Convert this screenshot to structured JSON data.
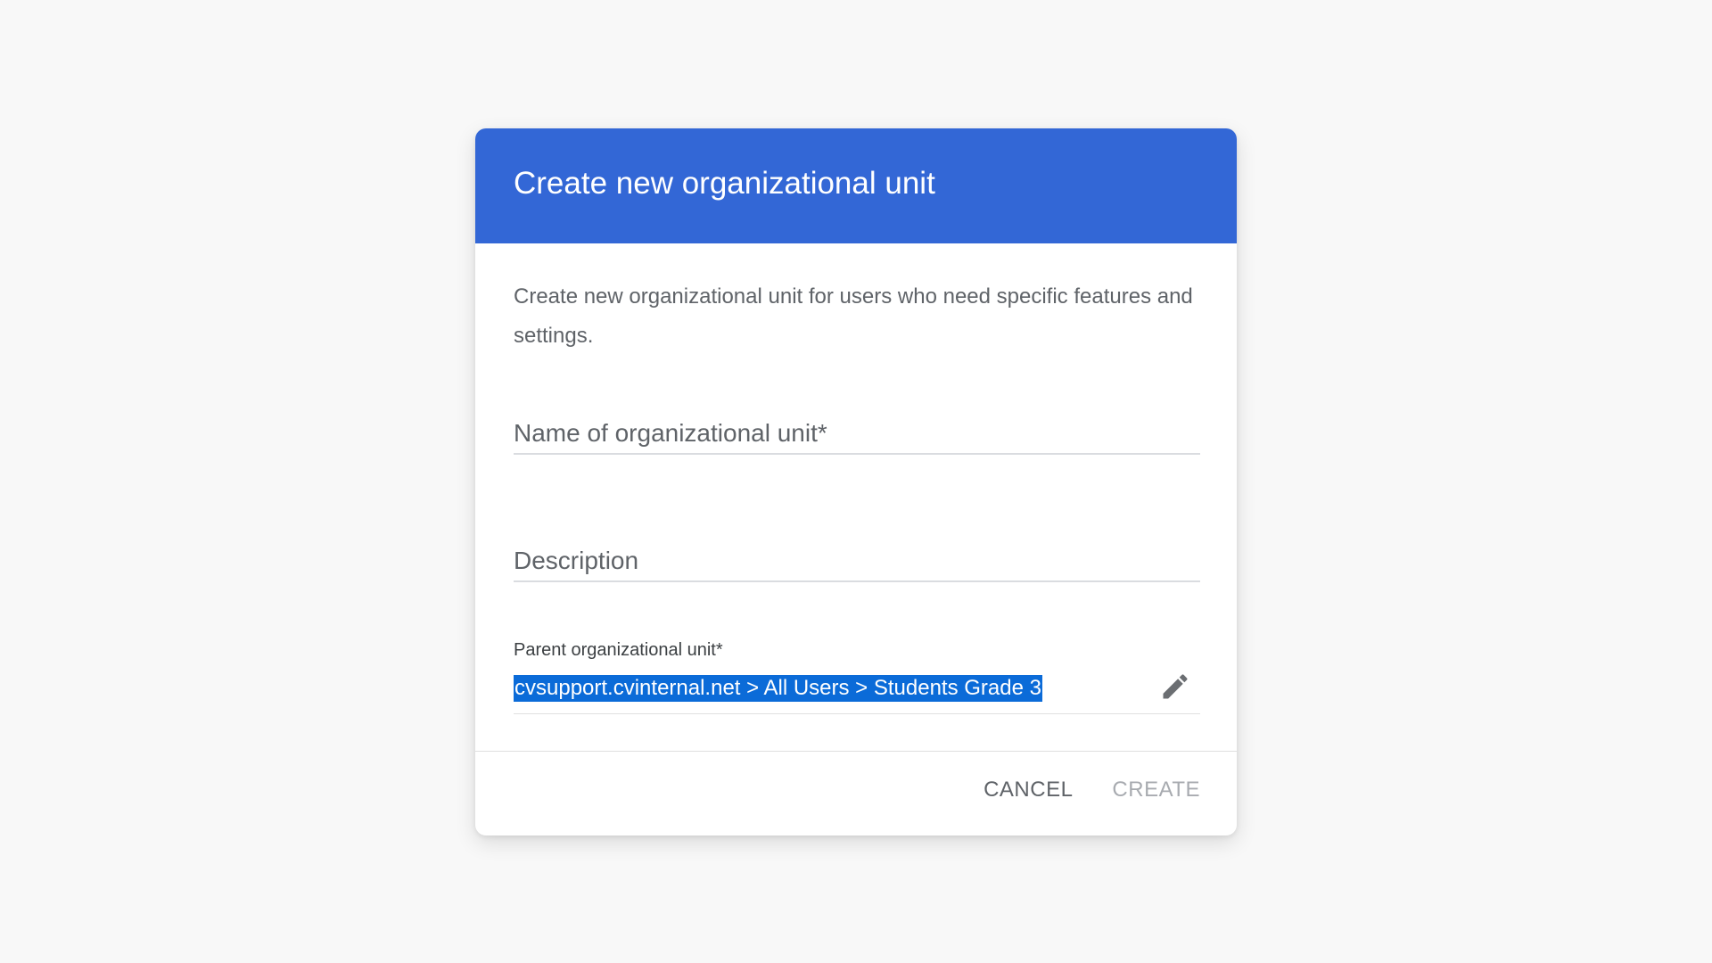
{
  "dialog": {
    "title": "Create new organizational unit",
    "intro": "Create new organizational unit for users who need specific features and settings.",
    "fields": {
      "name_placeholder": "Name of organizational unit*",
      "name_value": "",
      "description_placeholder": "Description",
      "description_value": ""
    },
    "parent": {
      "label": "Parent organizational unit*",
      "value": "cvsupport.cvinternal.net > All Users > Students Grade 3",
      "edit_icon": "pencil-icon"
    },
    "actions": {
      "cancel_label": "CANCEL",
      "create_label": "CREATE",
      "create_enabled": false
    }
  },
  "colors": {
    "header_bg": "#3367d6",
    "selection_bg": "#0b6bd8",
    "page_bg": "#f8f8f8"
  }
}
